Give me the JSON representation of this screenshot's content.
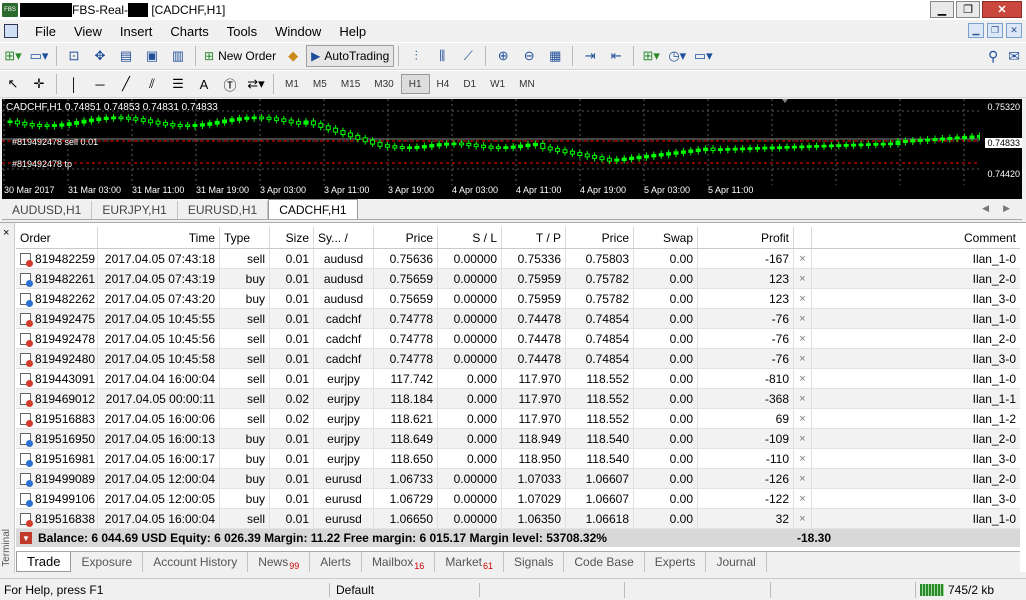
{
  "window": {
    "title": "FBS-Real-",
    "title_suffix": " [CADCHF,H1]",
    "app_icon_text": "FBS",
    "minimize": "▁",
    "maximize": "❐",
    "close": "✕"
  },
  "menu": [
    "File",
    "View",
    "Insert",
    "Charts",
    "Tools",
    "Window",
    "Help"
  ],
  "toolbar": {
    "new_order_label": "New Order",
    "autotrading_label": "AutoTrading",
    "timeframes": [
      "M1",
      "M5",
      "M15",
      "M30",
      "H1",
      "H4",
      "D1",
      "W1",
      "MN"
    ],
    "active_timeframe": "H1"
  },
  "chart": {
    "header": "CADCHF,H1  0.74851 0.74853 0.74831 0.74833",
    "line_sell": "#819492478 sell 0.01",
    "line_tp": "#819492478 tp",
    "price_labels": [
      "0.75320",
      "0.74833",
      "0.74420"
    ],
    "current_price": "0.74833",
    "time_labels": [
      "30 Mar 2017",
      "31 Mar 03:00",
      "31 Mar 11:00",
      "31 Mar 19:00",
      "3 Apr 03:00",
      "3 Apr 11:00",
      "3 Apr 19:00",
      "4 Apr 03:00",
      "4 Apr 11:00",
      "4 Apr 19:00",
      "5 Apr 03:00",
      "5 Apr 11:00"
    ],
    "colors": {
      "bull": "#00ff00",
      "bear": "#000000",
      "grid": "#5a5a5a",
      "sell_line": "#ff0000",
      "tp_line": "#ff0000"
    }
  },
  "chart_tabs": [
    "AUDUSD,H1",
    "EURJPY,H1",
    "EURUSD,H1",
    "CADCHF,H1"
  ],
  "active_chart_tab": "CADCHF,H1",
  "terminal": {
    "vertical_label": "Terminal",
    "close": "×",
    "columns": [
      "Order",
      "Time",
      "Type",
      "Size",
      "Sy... /",
      "Price",
      "S / L",
      "T / P",
      "Price",
      "Swap",
      "Profit",
      "",
      "Comment"
    ],
    "rows": [
      {
        "order": "819482259",
        "time": "2017.04.05 07:43:18",
        "type": "sell",
        "size": "0.01",
        "symbol": "audusd",
        "price": "0.75636",
        "sl": "0.00000",
        "tp": "0.75336",
        "cur_price": "0.75803",
        "swap": "0.00",
        "profit": "-167",
        "comment": "Ilan_1-0"
      },
      {
        "order": "819482261",
        "time": "2017.04.05 07:43:19",
        "type": "buy",
        "size": "0.01",
        "symbol": "audusd",
        "price": "0.75659",
        "sl": "0.00000",
        "tp": "0.75959",
        "cur_price": "0.75782",
        "swap": "0.00",
        "profit": "123",
        "comment": "Ilan_2-0"
      },
      {
        "order": "819482262",
        "time": "2017.04.05 07:43:20",
        "type": "buy",
        "size": "0.01",
        "symbol": "audusd",
        "price": "0.75659",
        "sl": "0.00000",
        "tp": "0.75959",
        "cur_price": "0.75782",
        "swap": "0.00",
        "profit": "123",
        "comment": "Ilan_3-0"
      },
      {
        "order": "819492475",
        "time": "2017.04.05 10:45:55",
        "type": "sell",
        "size": "0.01",
        "symbol": "cadchf",
        "price": "0.74778",
        "sl": "0.00000",
        "tp": "0.74478",
        "cur_price": "0.74854",
        "swap": "0.00",
        "profit": "-76",
        "comment": "Ilan_1-0"
      },
      {
        "order": "819492478",
        "time": "2017.04.05 10:45:56",
        "type": "sell",
        "size": "0.01",
        "symbol": "cadchf",
        "price": "0.74778",
        "sl": "0.00000",
        "tp": "0.74478",
        "cur_price": "0.74854",
        "swap": "0.00",
        "profit": "-76",
        "comment": "Ilan_2-0"
      },
      {
        "order": "819492480",
        "time": "2017.04.05 10:45:58",
        "type": "sell",
        "size": "0.01",
        "symbol": "cadchf",
        "price": "0.74778",
        "sl": "0.00000",
        "tp": "0.74478",
        "cur_price": "0.74854",
        "swap": "0.00",
        "profit": "-76",
        "comment": "Ilan_3-0"
      },
      {
        "order": "819443091",
        "time": "2017.04.04 16:00:04",
        "type": "sell",
        "size": "0.01",
        "symbol": "eurjpy",
        "price": "117.742",
        "sl": "0.000",
        "tp": "117.970",
        "cur_price": "118.552",
        "swap": "0.00",
        "profit": "-810",
        "comment": "Ilan_1-0"
      },
      {
        "order": "819469012",
        "time": "2017.04.05 00:00:11",
        "type": "sell",
        "size": "0.02",
        "symbol": "eurjpy",
        "price": "118.184",
        "sl": "0.000",
        "tp": "117.970",
        "cur_price": "118.552",
        "swap": "0.00",
        "profit": "-368",
        "comment": "Ilan_1-1"
      },
      {
        "order": "819516883",
        "time": "2017.04.05 16:00:06",
        "type": "sell",
        "size": "0.02",
        "symbol": "eurjpy",
        "price": "118.621",
        "sl": "0.000",
        "tp": "117.970",
        "cur_price": "118.552",
        "swap": "0.00",
        "profit": "69",
        "comment": "Ilan_1-2"
      },
      {
        "order": "819516950",
        "time": "2017.04.05 16:00:13",
        "type": "buy",
        "size": "0.01",
        "symbol": "eurjpy",
        "price": "118.649",
        "sl": "0.000",
        "tp": "118.949",
        "cur_price": "118.540",
        "swap": "0.00",
        "profit": "-109",
        "comment": "Ilan_2-0"
      },
      {
        "order": "819516981",
        "time": "2017.04.05 16:00:17",
        "type": "buy",
        "size": "0.01",
        "symbol": "eurjpy",
        "price": "118.650",
        "sl": "0.000",
        "tp": "118.950",
        "cur_price": "118.540",
        "swap": "0.00",
        "profit": "-110",
        "comment": "Ilan_3-0"
      },
      {
        "order": "819499089",
        "time": "2017.04.05 12:00:04",
        "type": "buy",
        "size": "0.01",
        "symbol": "eurusd",
        "price": "1.06733",
        "sl": "0.00000",
        "tp": "1.07033",
        "cur_price": "1.06607",
        "swap": "0.00",
        "profit": "-126",
        "comment": "Ilan_2-0"
      },
      {
        "order": "819499106",
        "time": "2017.04.05 12:00:05",
        "type": "buy",
        "size": "0.01",
        "symbol": "eurusd",
        "price": "1.06729",
        "sl": "0.00000",
        "tp": "1.07029",
        "cur_price": "1.06607",
        "swap": "0.00",
        "profit": "-122",
        "comment": "Ilan_3-0"
      },
      {
        "order": "819516838",
        "time": "2017.04.05 16:00:04",
        "type": "sell",
        "size": "0.01",
        "symbol": "eurusd",
        "price": "1.06650",
        "sl": "0.00000",
        "tp": "1.06350",
        "cur_price": "1.06618",
        "swap": "0.00",
        "profit": "32",
        "comment": "Ilan_1-0"
      }
    ],
    "balance_line": "Balance: 6 044.69 USD  Equity: 6 026.39  Margin: 11.22  Free margin: 6 015.17  Margin level: 53708.32%",
    "total_profit": "-18.30",
    "tabs": [
      {
        "label": "Trade",
        "badge": ""
      },
      {
        "label": "Exposure",
        "badge": ""
      },
      {
        "label": "Account History",
        "badge": ""
      },
      {
        "label": "News",
        "badge": "99"
      },
      {
        "label": "Alerts",
        "badge": ""
      },
      {
        "label": "Mailbox",
        "badge": "16"
      },
      {
        "label": "Market",
        "badge": "61"
      },
      {
        "label": "Signals",
        "badge": ""
      },
      {
        "label": "Code Base",
        "badge": ""
      },
      {
        "label": "Experts",
        "badge": ""
      },
      {
        "label": "Journal",
        "badge": ""
      }
    ],
    "active_tab": "Trade"
  },
  "status": {
    "help": "For Help, press F1",
    "profile": "Default",
    "traffic": "745/2 kb"
  },
  "icons": {
    "sell_dot": "#d23b2a",
    "buy_dot": "#2a6fd2"
  }
}
